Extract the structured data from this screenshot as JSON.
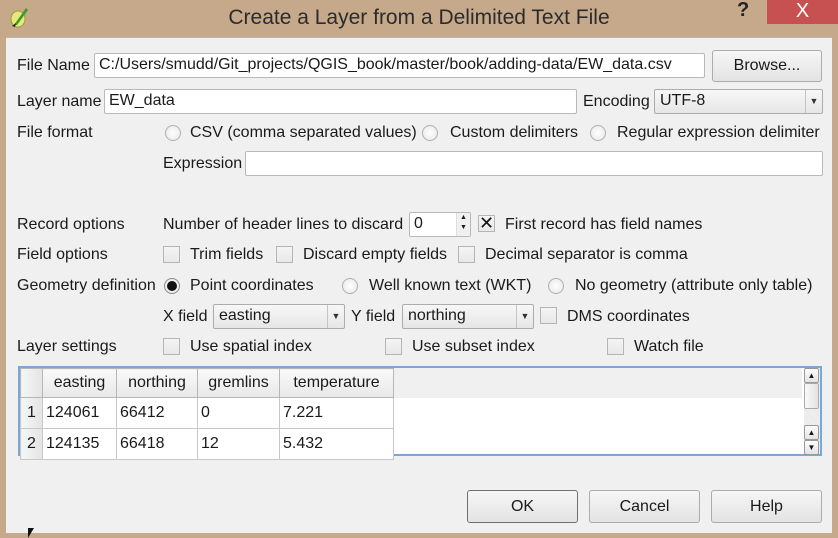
{
  "window": {
    "title": "Create a Layer from a Delimited Text File",
    "help_label": "?",
    "close_label": "X",
    "app_icon": "qgis-logo-icon"
  },
  "file": {
    "label": "File Name",
    "value": "C:/Users/smudd/Git_projects/QGIS_book/master/book/adding-data/EW_data.csv",
    "browse_label": "Browse..."
  },
  "layer": {
    "label": "Layer name",
    "value": "EW_data",
    "encoding_label": "Encoding",
    "encoding_value": "UTF-8"
  },
  "file_format": {
    "label": "File format",
    "options": [
      {
        "label": "CSV (comma separated values)",
        "checked": false
      },
      {
        "label": "Custom delimiters",
        "checked": false
      },
      {
        "label": "Regular expression delimiter",
        "checked": false
      }
    ],
    "expression_label": "Expression",
    "expression_value": ""
  },
  "record_options": {
    "label": "Record options",
    "header_lines_label": "Number of header lines to discard",
    "header_lines_value": "0",
    "first_record_label": "First record has field names",
    "first_record_checked": true,
    "check_mark": "✕"
  },
  "field_options": {
    "label": "Field options",
    "options": [
      {
        "label": "Trim fields",
        "checked": false
      },
      {
        "label": "Discard empty fields",
        "checked": false
      },
      {
        "label": "Decimal separator is comma",
        "checked": false
      }
    ]
  },
  "geometry": {
    "label": "Geometry definition",
    "options": [
      {
        "label": "Point coordinates",
        "checked": true
      },
      {
        "label": "Well known text (WKT)",
        "checked": false
      },
      {
        "label": "No geometry (attribute only table)",
        "checked": false
      }
    ],
    "x_field_label": "X field",
    "x_field_value": "easting",
    "y_field_label": "Y field",
    "y_field_value": "northing",
    "dms_label": "DMS coordinates",
    "dms_checked": false
  },
  "layer_settings": {
    "label": "Layer settings",
    "options": [
      {
        "label": "Use spatial index",
        "checked": false
      },
      {
        "label": "Use subset index",
        "checked": false
      },
      {
        "label": "Watch file",
        "checked": false
      }
    ]
  },
  "preview": {
    "columns": [
      "easting",
      "northing",
      "gremlins",
      "temperature"
    ],
    "rows": [
      {
        "num": "1",
        "cells": [
          "124061",
          "66412",
          "0",
          "7.221"
        ]
      },
      {
        "num": "2",
        "cells": [
          "124135",
          "66418",
          "12",
          "5.432"
        ]
      }
    ]
  },
  "buttons": {
    "ok": "OK",
    "cancel": "Cancel",
    "help": "Help"
  },
  "glyphs": {
    "arrow_down": "▼",
    "arrow_up": "▲"
  }
}
